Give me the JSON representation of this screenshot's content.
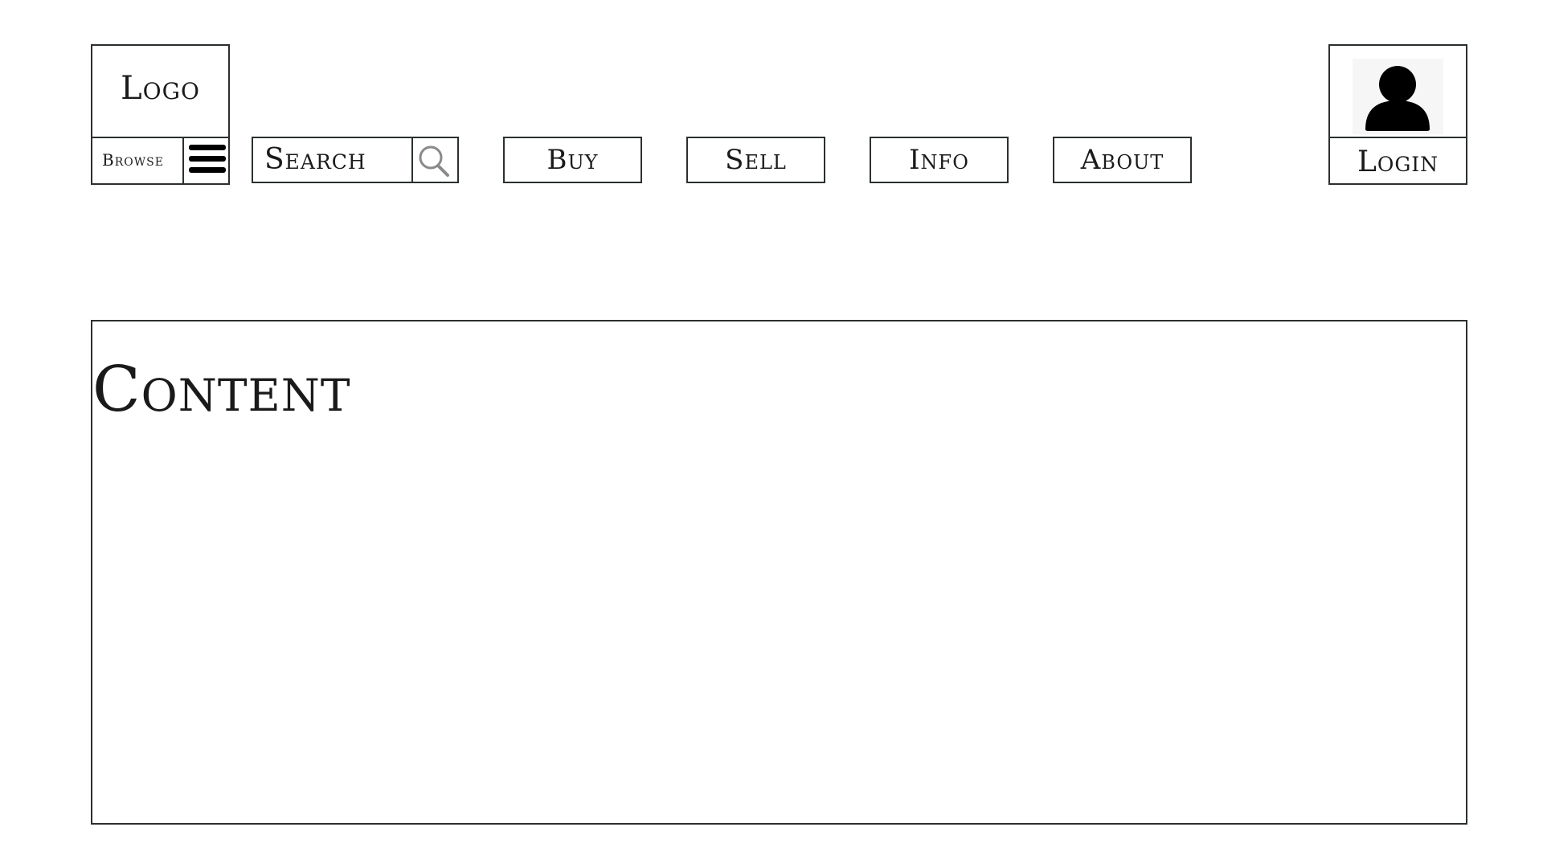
{
  "header": {
    "logo": "Logo",
    "browse_label": "Browse",
    "search_label": "Search",
    "nav": {
      "buy": "Buy",
      "sell": "Sell",
      "info": "Info",
      "about": "About"
    },
    "login_label": "Login"
  },
  "main": {
    "content_title": "Content"
  },
  "icons": {
    "menu": "hamburger-menu-icon",
    "search": "magnifier-icon",
    "user": "user-avatar-icon"
  }
}
